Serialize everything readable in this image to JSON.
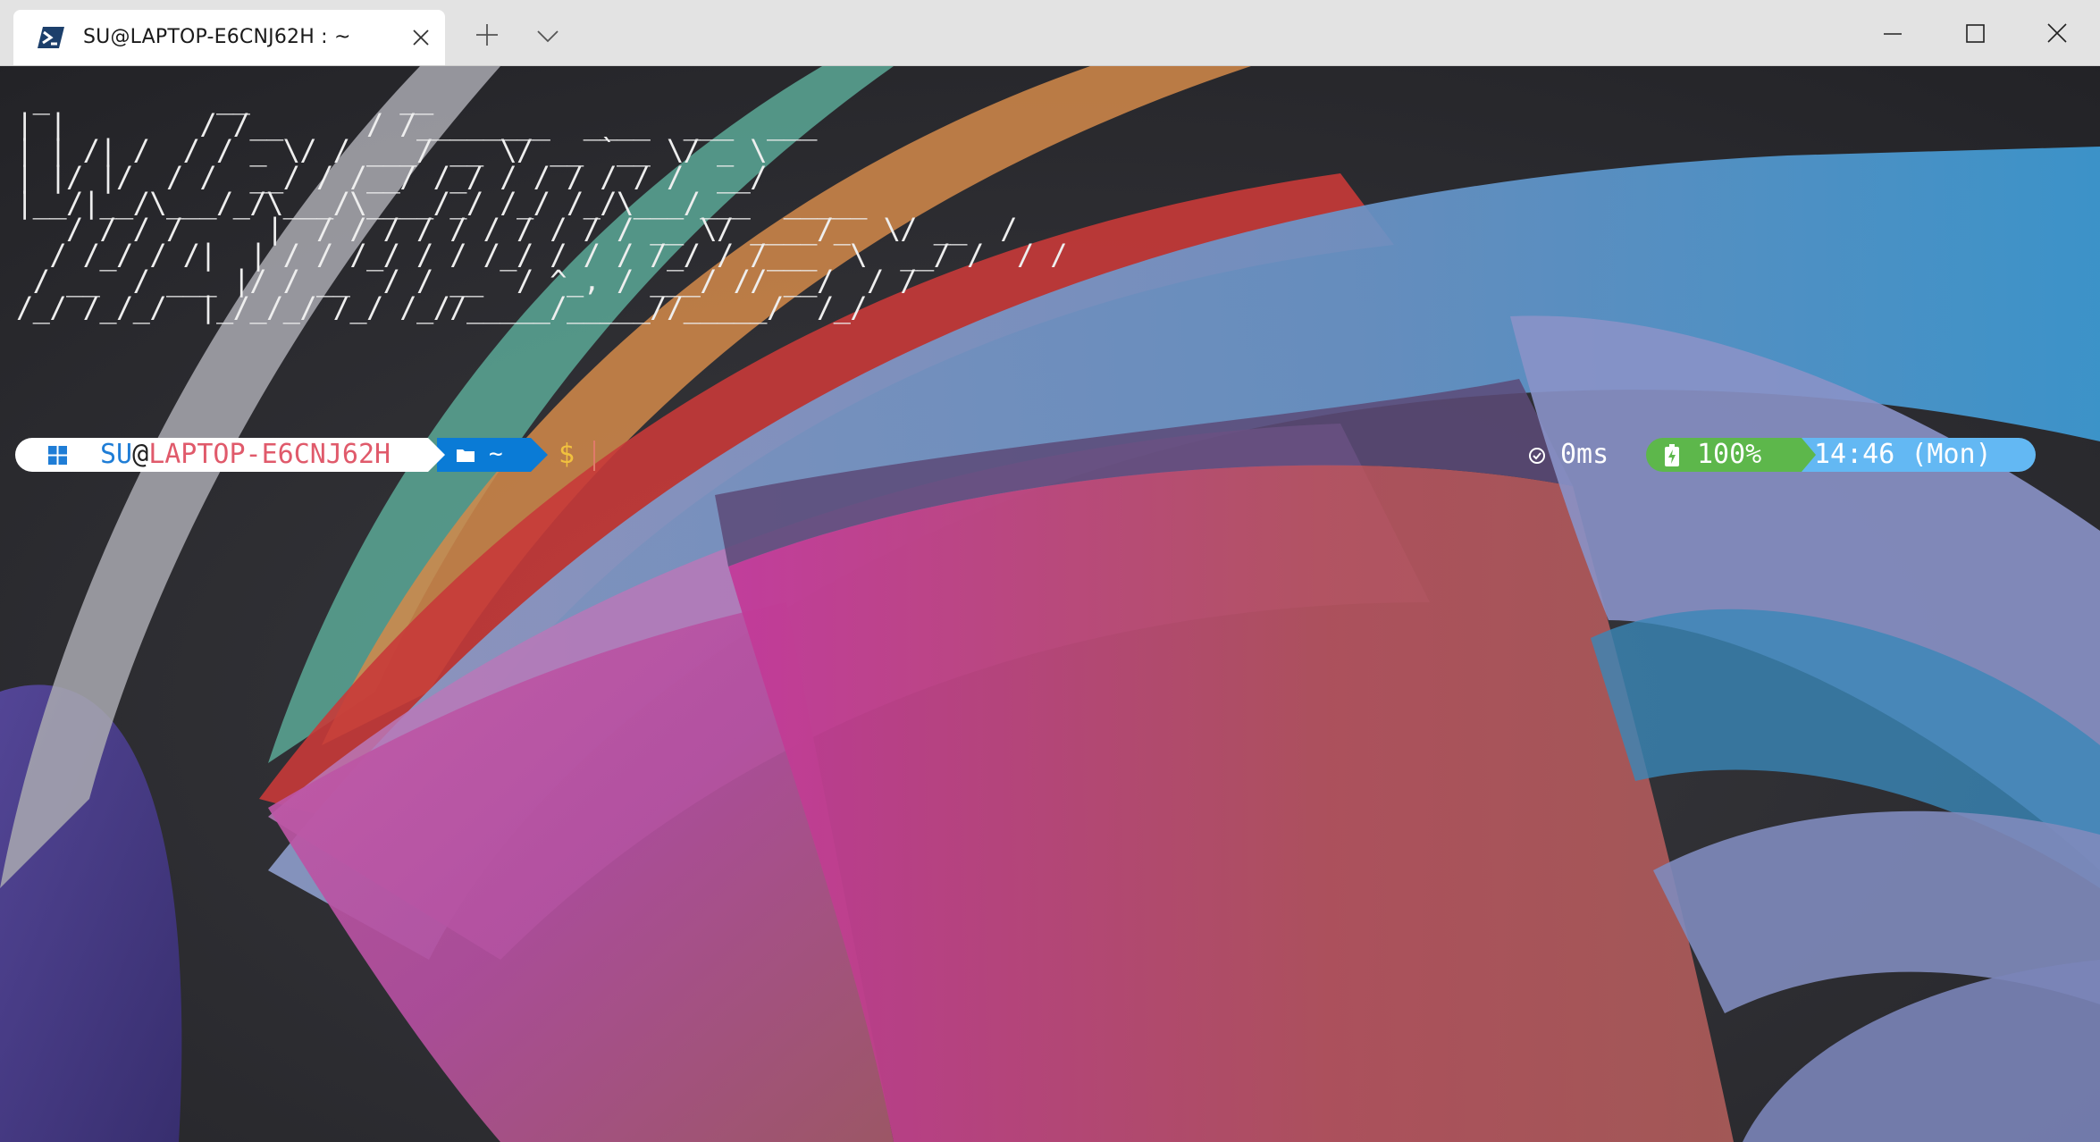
{
  "tab": {
    "title": "SU@LAPTOP-E6CNJ62H : ~",
    "icon": "powershell-icon"
  },
  "titlebar": {
    "new_tab_icon": "plus-icon",
    "dropdown_icon": "chevron-down-icon",
    "minimize_icon": "minimize-icon",
    "maximize_icon": "maximize-icon",
    "close_icon": "close-icon"
  },
  "terminal": {
    "ascii_banner": " _          __         __\n| |        / /__     / /________  ____  ___  ___\n| | /| /  / / _ \\/ / ___/ __ \\/ __ `__ \\/ _ \\\n| |/ |/  / /  __/ / /__/ /_/ / / / / / /  __/\n|__/|__/\\___/_/\\___/\\____/_/ /_/ /_/\\___/___  _____\n   / / / /     |  / / / / / / / / / / __ \\/ ____/_  \\/ __  /\n  / /_/ / /|  | / / /_/ / / /_/ / / / /_/ / /___  \\  __/ /  / /\n / __  / ___ |/ / __  / / __  / ^_, / ___/ // __/  / /\n/_/ /_/_/  |_/_/_/ /_/ /_//_____/_____//_____/  /_/"
  },
  "prompt": {
    "user": "SU",
    "at": "@",
    "host": "LAPTOP-E6CNJ62H",
    "path": "~",
    "symbol": "$",
    "exec_time": "0ms",
    "battery": "100%",
    "clock": "14:46 (Mon)"
  },
  "colors": {
    "user": "#1f7dd6",
    "host": "#e05a6b",
    "path_bg": "#0a7bd6",
    "dollar": "#f1c13e",
    "battery_bg": "#5db74b",
    "time_bg": "#63b8f3"
  }
}
